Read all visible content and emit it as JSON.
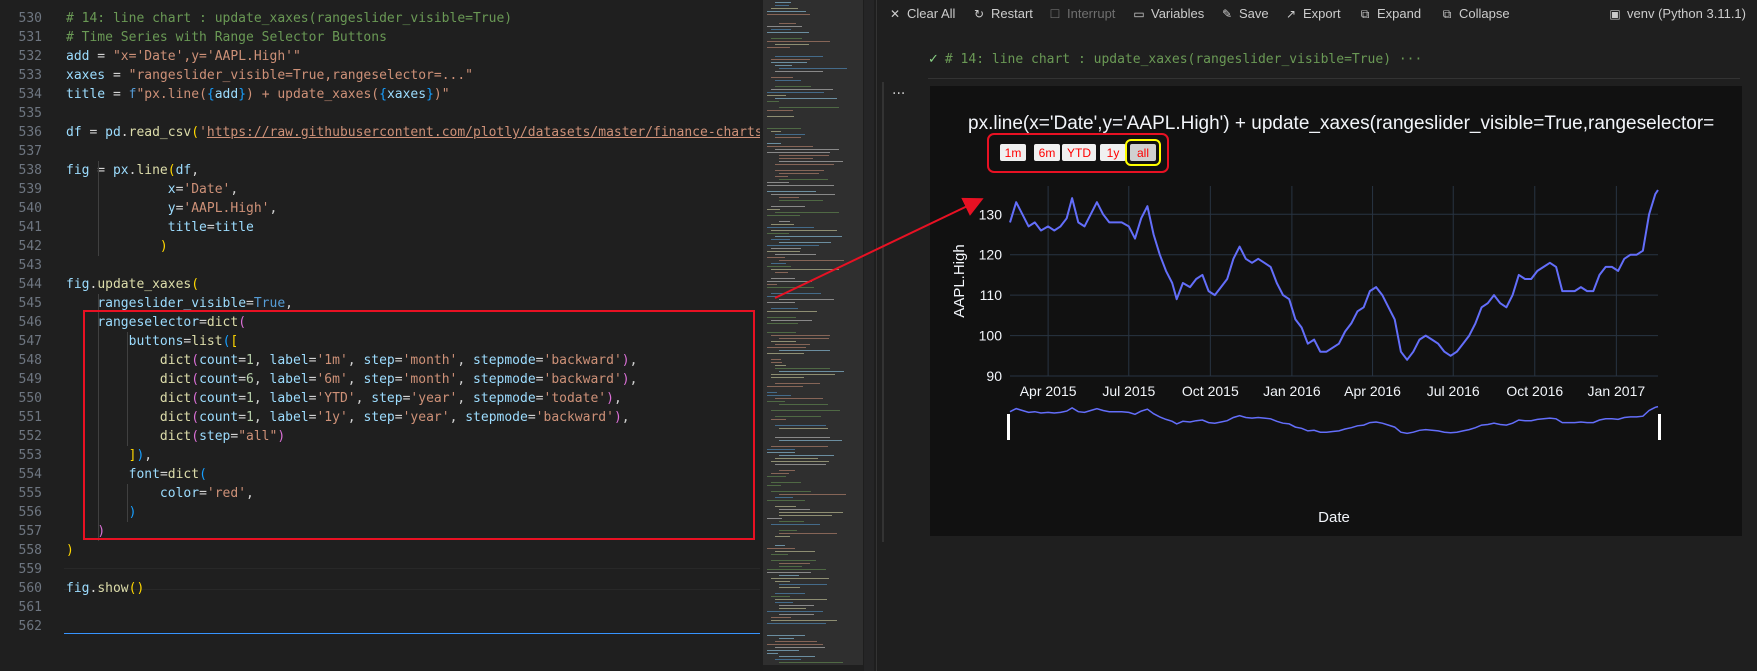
{
  "editor": {
    "lines": [
      {
        "n": "530",
        "tokens": [
          [
            "# 14: line chart : update_xaxes(rangeslider_visible=True)",
            "com"
          ]
        ]
      },
      {
        "n": "531",
        "tokens": [
          [
            "# Time Series with Range Selector Buttons",
            "com"
          ]
        ]
      },
      {
        "n": "532",
        "tokens": [
          [
            "add",
            "var"
          ],
          [
            " = ",
            "plain"
          ],
          [
            "\"x='Date',y='AAPL.High'\"",
            "str"
          ]
        ]
      },
      {
        "n": "533",
        "tokens": [
          [
            "xaxes",
            "var"
          ],
          [
            " = ",
            "plain"
          ],
          [
            "\"rangeslider_visible=True,rangeselector=...\"",
            "str"
          ]
        ]
      },
      {
        "n": "534",
        "tokens": [
          [
            "title",
            "var"
          ],
          [
            " = ",
            "plain"
          ],
          [
            "f",
            "kw"
          ],
          [
            "\"px.line(",
            "str"
          ],
          [
            "{",
            "brk3"
          ],
          [
            "add",
            "var"
          ],
          [
            "}",
            "brk3"
          ],
          [
            ") + update_xaxes(",
            "str"
          ],
          [
            "{",
            "brk3"
          ],
          [
            "xaxes",
            "var"
          ],
          [
            "}",
            "brk3"
          ],
          [
            ")\"",
            "str"
          ]
        ]
      },
      {
        "n": "535",
        "tokens": []
      },
      {
        "n": "536",
        "tokens": [
          [
            "df",
            "var"
          ],
          [
            " = ",
            "plain"
          ],
          [
            "pd",
            "var"
          ],
          [
            ".",
            "plain"
          ],
          [
            "read_csv",
            "fn"
          ],
          [
            "(",
            "brk"
          ],
          [
            "'",
            "str"
          ],
          [
            "https://raw.githubusercontent.com/plotly/datasets/master/finance-charts-a",
            "url"
          ]
        ]
      },
      {
        "n": "537",
        "tokens": []
      },
      {
        "n": "538",
        "tokens": [
          [
            "fig",
            "var"
          ],
          [
            " = ",
            "plain"
          ],
          [
            "px",
            "var"
          ],
          [
            ".",
            "plain"
          ],
          [
            "line",
            "fn"
          ],
          [
            "(",
            "brk"
          ],
          [
            "df",
            "var"
          ],
          [
            ",",
            "plain"
          ]
        ]
      },
      {
        "n": "539",
        "tokens": [
          [
            "             ",
            "plain"
          ],
          [
            "x",
            "var"
          ],
          [
            "=",
            "plain"
          ],
          [
            "'Date'",
            "str"
          ],
          [
            ",",
            "plain"
          ]
        ]
      },
      {
        "n": "540",
        "tokens": [
          [
            "             ",
            "plain"
          ],
          [
            "y",
            "var"
          ],
          [
            "=",
            "plain"
          ],
          [
            "'AAPL.High'",
            "str"
          ],
          [
            ",",
            "plain"
          ]
        ]
      },
      {
        "n": "541",
        "tokens": [
          [
            "             ",
            "plain"
          ],
          [
            "title",
            "var"
          ],
          [
            "=",
            "plain"
          ],
          [
            "title",
            "var"
          ]
        ]
      },
      {
        "n": "542",
        "tokens": [
          [
            "            ",
            "plain"
          ],
          [
            ")",
            "brk"
          ]
        ]
      },
      {
        "n": "543",
        "tokens": []
      },
      {
        "n": "544",
        "tokens": [
          [
            "fig",
            "var"
          ],
          [
            ".",
            "plain"
          ],
          [
            "update_xaxes",
            "fn"
          ],
          [
            "(",
            "brk"
          ]
        ]
      },
      {
        "n": "545",
        "tokens": [
          [
            "    ",
            "plain"
          ],
          [
            "rangeslider_visible",
            "var"
          ],
          [
            "=",
            "plain"
          ],
          [
            "True",
            "kw"
          ],
          [
            ",",
            "plain"
          ]
        ]
      },
      {
        "n": "546",
        "tokens": [
          [
            "    ",
            "plain"
          ],
          [
            "rangeselector",
            "var"
          ],
          [
            "=",
            "plain"
          ],
          [
            "dict",
            "fn"
          ],
          [
            "(",
            "brk2"
          ]
        ]
      },
      {
        "n": "547",
        "tokens": [
          [
            "        ",
            "plain"
          ],
          [
            "buttons",
            "var"
          ],
          [
            "=",
            "plain"
          ],
          [
            "list",
            "fn"
          ],
          [
            "(",
            "brk3"
          ],
          [
            "[",
            "brk"
          ]
        ]
      },
      {
        "n": "548",
        "tokens": [
          [
            "            ",
            "plain"
          ],
          [
            "dict",
            "fn"
          ],
          [
            "(",
            "brk2"
          ],
          [
            "count",
            "var"
          ],
          [
            "=",
            "plain"
          ],
          [
            "1",
            "num"
          ],
          [
            ", ",
            "plain"
          ],
          [
            "label",
            "var"
          ],
          [
            "=",
            "plain"
          ],
          [
            "'1m'",
            "str"
          ],
          [
            ", ",
            "plain"
          ],
          [
            "step",
            "var"
          ],
          [
            "=",
            "plain"
          ],
          [
            "'month'",
            "str"
          ],
          [
            ", ",
            "plain"
          ],
          [
            "stepmode",
            "var"
          ],
          [
            "=",
            "plain"
          ],
          [
            "'backward'",
            "str"
          ],
          [
            ")",
            "brk2"
          ],
          [
            ",",
            "plain"
          ]
        ]
      },
      {
        "n": "549",
        "tokens": [
          [
            "            ",
            "plain"
          ],
          [
            "dict",
            "fn"
          ],
          [
            "(",
            "brk2"
          ],
          [
            "count",
            "var"
          ],
          [
            "=",
            "plain"
          ],
          [
            "6",
            "num"
          ],
          [
            ", ",
            "plain"
          ],
          [
            "label",
            "var"
          ],
          [
            "=",
            "plain"
          ],
          [
            "'6m'",
            "str"
          ],
          [
            ", ",
            "plain"
          ],
          [
            "step",
            "var"
          ],
          [
            "=",
            "plain"
          ],
          [
            "'month'",
            "str"
          ],
          [
            ", ",
            "plain"
          ],
          [
            "stepmode",
            "var"
          ],
          [
            "=",
            "plain"
          ],
          [
            "'backward'",
            "str"
          ],
          [
            ")",
            "brk2"
          ],
          [
            ",",
            "plain"
          ]
        ]
      },
      {
        "n": "550",
        "tokens": [
          [
            "            ",
            "plain"
          ],
          [
            "dict",
            "fn"
          ],
          [
            "(",
            "brk2"
          ],
          [
            "count",
            "var"
          ],
          [
            "=",
            "plain"
          ],
          [
            "1",
            "num"
          ],
          [
            ", ",
            "plain"
          ],
          [
            "label",
            "var"
          ],
          [
            "=",
            "plain"
          ],
          [
            "'YTD'",
            "str"
          ],
          [
            ", ",
            "plain"
          ],
          [
            "step",
            "var"
          ],
          [
            "=",
            "plain"
          ],
          [
            "'year'",
            "str"
          ],
          [
            ", ",
            "plain"
          ],
          [
            "stepmode",
            "var"
          ],
          [
            "=",
            "plain"
          ],
          [
            "'todate'",
            "str"
          ],
          [
            ")",
            "brk2"
          ],
          [
            ",",
            "plain"
          ]
        ]
      },
      {
        "n": "551",
        "tokens": [
          [
            "            ",
            "plain"
          ],
          [
            "dict",
            "fn"
          ],
          [
            "(",
            "brk2"
          ],
          [
            "count",
            "var"
          ],
          [
            "=",
            "plain"
          ],
          [
            "1",
            "num"
          ],
          [
            ", ",
            "plain"
          ],
          [
            "label",
            "var"
          ],
          [
            "=",
            "plain"
          ],
          [
            "'1y'",
            "str"
          ],
          [
            ", ",
            "plain"
          ],
          [
            "step",
            "var"
          ],
          [
            "=",
            "plain"
          ],
          [
            "'year'",
            "str"
          ],
          [
            ", ",
            "plain"
          ],
          [
            "stepmode",
            "var"
          ],
          [
            "=",
            "plain"
          ],
          [
            "'backward'",
            "str"
          ],
          [
            ")",
            "brk2"
          ],
          [
            ",",
            "plain"
          ]
        ]
      },
      {
        "n": "552",
        "tokens": [
          [
            "            ",
            "plain"
          ],
          [
            "dict",
            "fn"
          ],
          [
            "(",
            "brk2"
          ],
          [
            "step",
            "var"
          ],
          [
            "=",
            "plain"
          ],
          [
            "\"all\"",
            "str"
          ],
          [
            ")",
            "brk2"
          ]
        ]
      },
      {
        "n": "553",
        "tokens": [
          [
            "        ",
            "plain"
          ],
          [
            "]",
            "brk"
          ],
          [
            ")",
            "brk3"
          ],
          [
            ",",
            "plain"
          ]
        ]
      },
      {
        "n": "554",
        "tokens": [
          [
            "        ",
            "plain"
          ],
          [
            "font",
            "var"
          ],
          [
            "=",
            "plain"
          ],
          [
            "dict",
            "fn"
          ],
          [
            "(",
            "brk3"
          ]
        ]
      },
      {
        "n": "555",
        "tokens": [
          [
            "            ",
            "plain"
          ],
          [
            "color",
            "var"
          ],
          [
            "=",
            "plain"
          ],
          [
            "'red'",
            "str"
          ],
          [
            ",",
            "plain"
          ]
        ]
      },
      {
        "n": "556",
        "tokens": [
          [
            "        ",
            "plain"
          ],
          [
            ")",
            "brk3"
          ]
        ]
      },
      {
        "n": "557",
        "tokens": [
          [
            "    ",
            "plain"
          ],
          [
            ")",
            "brk2"
          ]
        ]
      },
      {
        "n": "558",
        "tokens": [
          [
            ")",
            "brk"
          ]
        ]
      },
      {
        "n": "559",
        "tokens": []
      },
      {
        "n": "560",
        "tokens": [
          [
            "fig",
            "var"
          ],
          [
            ".",
            "plain"
          ],
          [
            "show",
            "fn"
          ],
          [
            "(",
            "brk"
          ],
          [
            ")",
            "brk"
          ]
        ]
      },
      {
        "n": "561",
        "tokens": []
      },
      {
        "n": "562",
        "tokens": []
      }
    ]
  },
  "toolbar": {
    "clear_all": "Clear All",
    "restart": "Restart",
    "interrupt": "Interrupt",
    "variables": "Variables",
    "save": "Save",
    "export": "Export",
    "expand": "Expand",
    "collapse": "Collapse",
    "kernel": "venv (Python 3.11.1)"
  },
  "cell": {
    "header": "# 14: line chart : update_xaxes(rangeslider_visible=True) ···",
    "more": "···"
  },
  "colors": {
    "line": "#636efa",
    "selector_text": "#ff0000",
    "annotation": "#e81123",
    "active_button": "#ffff00"
  },
  "chart_data": {
    "type": "line",
    "title": "px.line(x='Date',y='AAPL.High') + update_xaxes(rangeslider_visible=True,rangeselector=",
    "xlabel": "Date",
    "ylabel": "AAPL.High",
    "ylim": [
      90,
      137
    ],
    "yticks": [
      90,
      100,
      110,
      120,
      130
    ],
    "xlim": [
      "2015-02-17",
      "2017-02-17"
    ],
    "xticks": [
      {
        "date": "2015-04-01",
        "label": "Apr 2015"
      },
      {
        "date": "2015-07-01",
        "label": "Jul 2015"
      },
      {
        "date": "2015-10-01",
        "label": "Oct 2015"
      },
      {
        "date": "2016-01-01",
        "label": "Jan 2016"
      },
      {
        "date": "2016-04-01",
        "label": "Apr 2016"
      },
      {
        "date": "2016-07-01",
        "label": "Jul 2016"
      },
      {
        "date": "2016-10-01",
        "label": "Oct 2016"
      },
      {
        "date": "2017-01-01",
        "label": "Jan 2017"
      }
    ],
    "range_selector": [
      "1m",
      "6m",
      "YTD",
      "1y",
      "all"
    ],
    "active_button": "all",
    "rangeslider": true,
    "grid": true,
    "x": [
      "2015-02-17",
      "2015-02-24",
      "2015-03-03",
      "2015-03-10",
      "2015-03-17",
      "2015-03-24",
      "2015-04-01",
      "2015-04-08",
      "2015-04-15",
      "2015-04-22",
      "2015-04-28",
      "2015-05-05",
      "2015-05-12",
      "2015-05-19",
      "2015-05-26",
      "2015-06-02",
      "2015-06-09",
      "2015-06-16",
      "2015-06-23",
      "2015-07-01",
      "2015-07-08",
      "2015-07-15",
      "2015-07-22",
      "2015-07-29",
      "2015-08-05",
      "2015-08-12",
      "2015-08-19",
      "2015-08-24",
      "2015-08-31",
      "2015-09-08",
      "2015-09-15",
      "2015-09-22",
      "2015-09-29",
      "2015-10-06",
      "2015-10-13",
      "2015-10-20",
      "2015-10-27",
      "2015-11-03",
      "2015-11-10",
      "2015-11-17",
      "2015-11-24",
      "2015-12-01",
      "2015-12-08",
      "2015-12-15",
      "2015-12-22",
      "2015-12-29",
      "2016-01-05",
      "2016-01-12",
      "2016-01-19",
      "2016-01-26",
      "2016-02-02",
      "2016-02-09",
      "2016-02-16",
      "2016-02-23",
      "2016-03-01",
      "2016-03-08",
      "2016-03-15",
      "2016-03-22",
      "2016-03-29",
      "2016-04-05",
      "2016-04-12",
      "2016-04-19",
      "2016-04-26",
      "2016-05-03",
      "2016-05-10",
      "2016-05-17",
      "2016-05-24",
      "2016-05-31",
      "2016-06-07",
      "2016-06-14",
      "2016-06-21",
      "2016-06-28",
      "2016-07-05",
      "2016-07-12",
      "2016-07-19",
      "2016-07-26",
      "2016-08-02",
      "2016-08-09",
      "2016-08-16",
      "2016-08-23",
      "2016-08-30",
      "2016-09-06",
      "2016-09-13",
      "2016-09-20",
      "2016-09-27",
      "2016-10-04",
      "2016-10-11",
      "2016-10-18",
      "2016-10-25",
      "2016-11-01",
      "2016-11-08",
      "2016-11-15",
      "2016-11-22",
      "2016-11-29",
      "2016-12-06",
      "2016-12-13",
      "2016-12-20",
      "2016-12-27",
      "2017-01-03",
      "2017-01-10",
      "2017-01-17",
      "2017-01-24",
      "2017-01-31",
      "2017-02-07",
      "2017-02-14",
      "2017-02-17"
    ],
    "series": [
      {
        "values": [
          128,
          133,
          130,
          127,
          128,
          126,
          127,
          126,
          127,
          129,
          134,
          128,
          127,
          130,
          133,
          130,
          128,
          128,
          128,
          127,
          124,
          129,
          132,
          125,
          120,
          116,
          113,
          109,
          113,
          112,
          114,
          115,
          111,
          110,
          112,
          114,
          119,
          122,
          119,
          118,
          119,
          118,
          117,
          113,
          110,
          109,
          104,
          102,
          98,
          99,
          96,
          96,
          97,
          98,
          101,
          103,
          106,
          107,
          111,
          112,
          110,
          107,
          104,
          96,
          94,
          96,
          99,
          100,
          99,
          98,
          96,
          95,
          96,
          98,
          100,
          103,
          107,
          108,
          110,
          108,
          107,
          110,
          115,
          114,
          114,
          116,
          117,
          118,
          117,
          111,
          111,
          111,
          112,
          111,
          111,
          115,
          117,
          117,
          116,
          119,
          120,
          120,
          121,
          130,
          135,
          136
        ]
      }
    ]
  }
}
